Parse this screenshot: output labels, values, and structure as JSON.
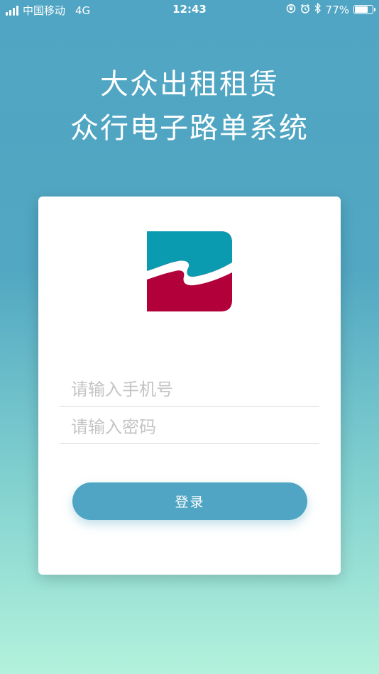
{
  "status_bar": {
    "carrier": "中国移动",
    "network": "4G",
    "time": "12:43",
    "battery_percent": "77%",
    "battery_level": 0.77
  },
  "title": {
    "line1": "大众出租租赁",
    "line2": "众行电子路单系统"
  },
  "form": {
    "phone_placeholder": "请输入手机号",
    "password_placeholder": "请输入密码",
    "login_label": "登录"
  },
  "colors": {
    "accent": "#4fa5c3",
    "logo_top": "#0a9bb1",
    "logo_bottom": "#b1003a"
  }
}
